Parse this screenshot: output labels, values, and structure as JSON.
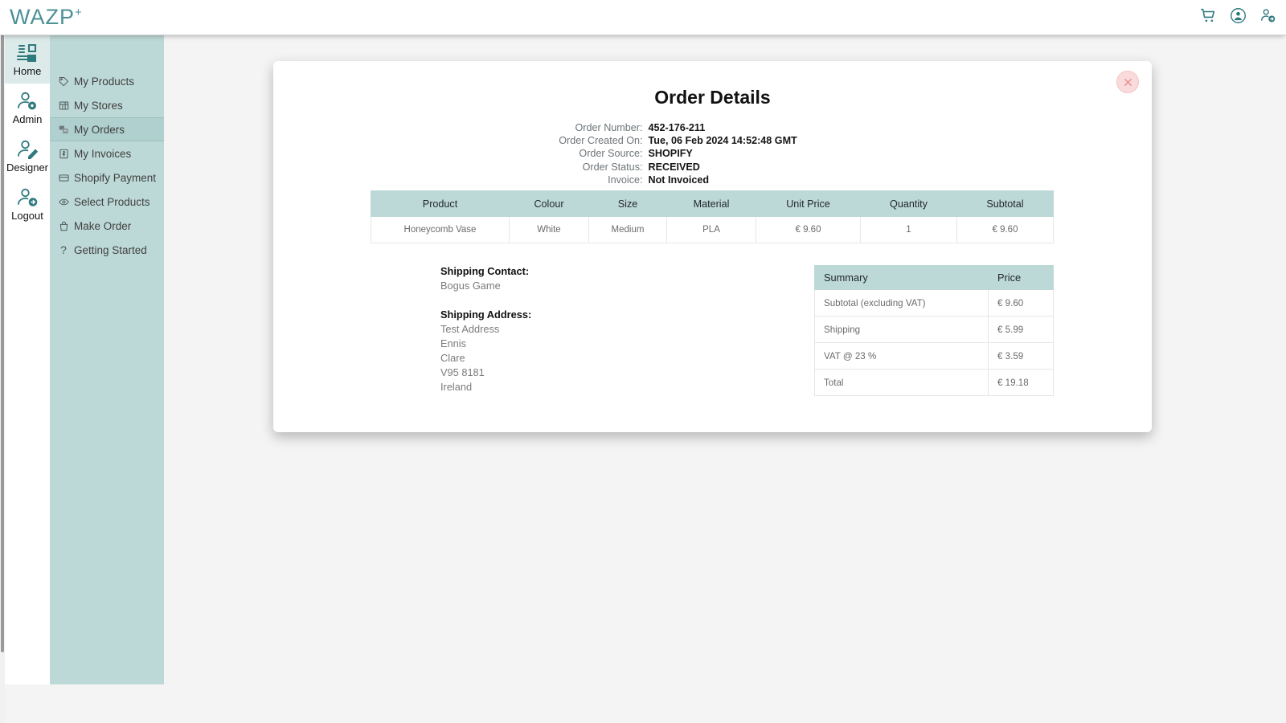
{
  "header": {
    "logo_text": "WAZP",
    "logo_plus": "+",
    "icons": [
      {
        "name": "cart-icon",
        "label": "Cart"
      },
      {
        "name": "account-circle-icon",
        "label": "Account"
      },
      {
        "name": "user-logout-icon",
        "label": "Logout"
      }
    ]
  },
  "rail": {
    "items": [
      {
        "label": "Home",
        "icon": "home-dashboard-icon",
        "active": true
      },
      {
        "label": "Admin",
        "icon": "user-gear-icon",
        "active": false
      },
      {
        "label": "Designer",
        "icon": "user-pencil-icon",
        "active": false
      },
      {
        "label": "Logout",
        "icon": "user-arrow-icon",
        "active": false
      }
    ]
  },
  "menu": {
    "items": [
      {
        "label": "My Products",
        "icon": "tag-icon",
        "active": false
      },
      {
        "label": "My Stores",
        "icon": "store-icon",
        "active": false
      },
      {
        "label": "My Orders",
        "icon": "orders-icon",
        "active": true
      },
      {
        "label": "My Invoices",
        "icon": "invoice-icon",
        "active": false
      },
      {
        "label": "Shopify Payment",
        "icon": "card-icon",
        "active": false
      },
      {
        "label": "Select Products",
        "icon": "eye-icon",
        "active": false
      },
      {
        "label": "Make Order",
        "icon": "bag-icon",
        "active": false
      },
      {
        "label": "Getting Started",
        "icon": "question-icon",
        "active": false
      }
    ]
  },
  "modal": {
    "title": "Order Details",
    "close_label": "Close",
    "meta": [
      {
        "label": "Order Number:",
        "value": "452-176-211"
      },
      {
        "label": "Order Created On:",
        "value": "Tue, 06 Feb 2024 14:52:48 GMT"
      },
      {
        "label": "Order Source:",
        "value": "SHOPIFY"
      },
      {
        "label": "Order Status:",
        "value": "RECEIVED"
      },
      {
        "label": "Invoice:",
        "value": "Not Invoiced"
      }
    ],
    "product_table": {
      "columns": [
        "Product",
        "Colour",
        "Size",
        "Material",
        "Unit Price",
        "Quantity",
        "Subtotal"
      ],
      "rows": [
        [
          "Honeycomb Vase",
          "White",
          "Medium",
          "PLA",
          "€ 9.60",
          "1",
          "€ 9.60"
        ]
      ]
    },
    "shipping": {
      "contact_heading": "Shipping Contact:",
      "contact_name": "Bogus Game",
      "address_heading": "Shipping Address:",
      "address_lines": [
        "Test Address",
        "Ennis",
        "Clare",
        "V95 8181",
        "Ireland"
      ]
    },
    "summary_table": {
      "columns": [
        "Summary",
        "Price"
      ],
      "rows": [
        [
          "Subtotal (excluding VAT)",
          "€ 9.60"
        ],
        [
          "Shipping",
          "€ 5.99"
        ],
        [
          "VAT @ 23 %",
          "€ 3.59"
        ],
        [
          "Total",
          "€ 19.18"
        ]
      ]
    }
  },
  "colors": {
    "brand_teal": "#4b9196",
    "menu_bg": "#bdd9d7",
    "menu_active": "#afd0ce",
    "rail_active": "#dceae9",
    "page_bg": "#f4f4f4",
    "close_bg": "#fadbdb",
    "close_stroke": "#e88b8b"
  }
}
